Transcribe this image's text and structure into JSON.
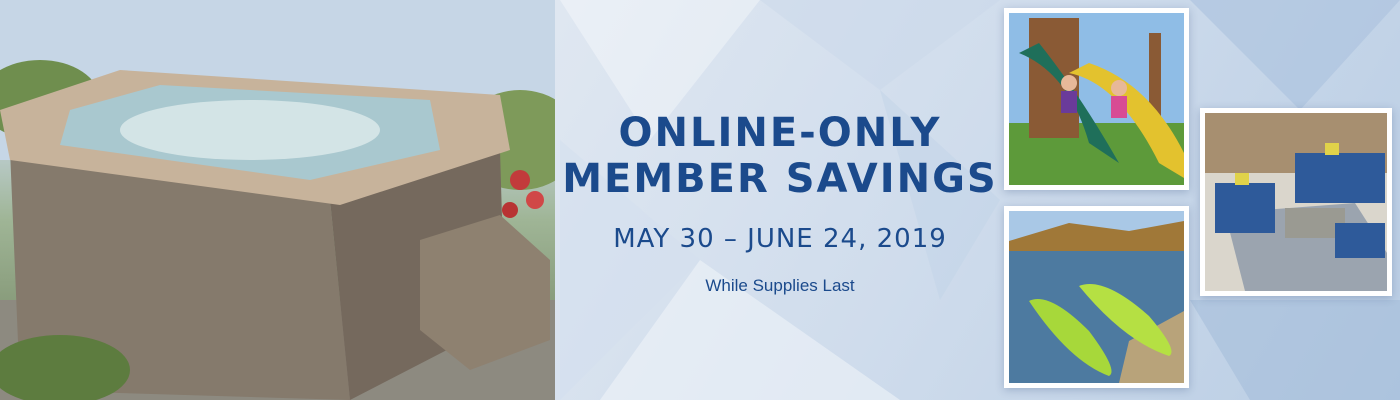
{
  "promo": {
    "headline_line1": "ONLINE-ONLY",
    "headline_line2": "MEMBER SAVINGS",
    "dates": "MAY 30 – JUNE 24, 2019",
    "note": "While Supplies Last"
  },
  "images": {
    "left": "hot-tub-photo",
    "top_right": "kids-on-slide-photo",
    "bottom_right": "kayaks-on-lake-photo",
    "far_right": "patio-furniture-photo"
  },
  "colors": {
    "brand_blue": "#1b4a8c",
    "background": "#dfe7f1"
  }
}
